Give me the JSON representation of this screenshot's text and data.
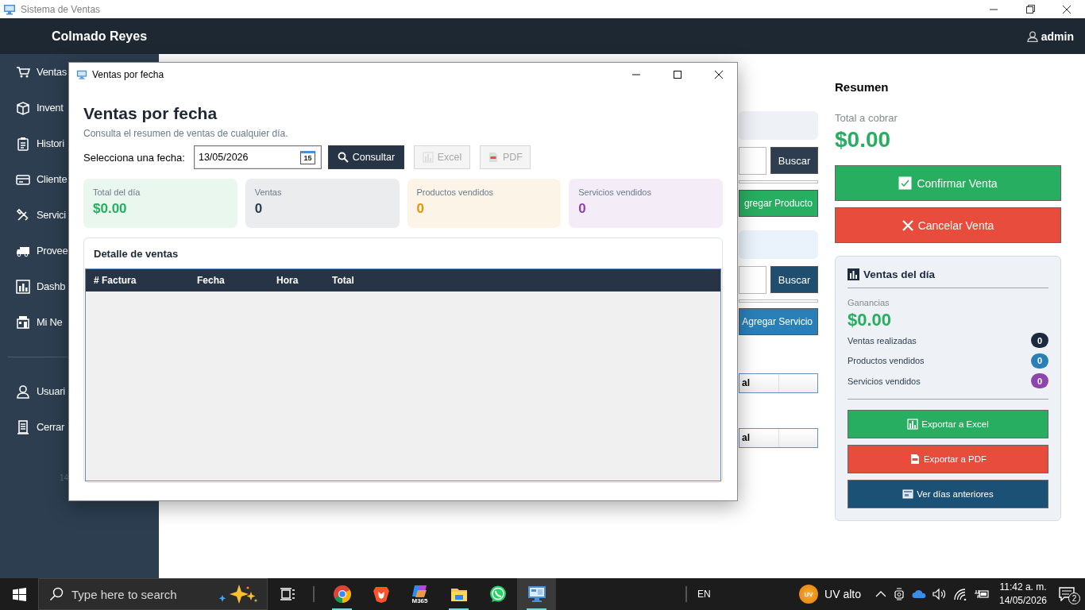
{
  "window": {
    "title": "Sistema de Ventas"
  },
  "header": {
    "brand": "Colmado Reyes",
    "user": "admin"
  },
  "sidebar": {
    "items": [
      {
        "label": "Ventas",
        "kind": "cart"
      },
      {
        "label": "Invent",
        "kind": "box"
      },
      {
        "label": "Histori",
        "kind": "clipboard"
      },
      {
        "label": "Cliente",
        "kind": "card"
      },
      {
        "label": "Servici",
        "kind": "tools"
      },
      {
        "label": "Provee",
        "kind": "truck"
      },
      {
        "label": "Dashb",
        "kind": "chart"
      },
      {
        "label": "Mi Ne",
        "kind": "building"
      }
    ],
    "bottom_items": [
      {
        "label": "Usuari",
        "kind": "user"
      },
      {
        "label": "Cerrar",
        "kind": "door"
      }
    ],
    "footer": "14"
  },
  "sales_form": {
    "product_search_button": "Buscar",
    "add_product_button": "gregar Producto",
    "service_search_button": "Buscar",
    "add_service_button": "Agregar Servicio",
    "product_table_cell": "al",
    "service_table_cell": "al"
  },
  "summary": {
    "title": "Resumen",
    "total_label": "Total a cobrar",
    "total": "$0.00",
    "confirm_button": "Confirmar Venta",
    "cancel_button": "Cancelar Venta",
    "daily": {
      "title": "Ventas del día",
      "profit_label": "Ganancias",
      "profit": "$0.00",
      "counts": [
        {
          "label": "Ventas realizadas",
          "value": "0",
          "color": "#1b2a3e"
        },
        {
          "label": "Productos vendidos",
          "value": "0",
          "color": "#2980b9"
        },
        {
          "label": "Servicios vendidos",
          "value": "0",
          "color": "#8e44ad"
        }
      ],
      "buttons": [
        {
          "label": "Exportar a Excel",
          "kind": "excel"
        },
        {
          "label": "Exportar a PDF",
          "kind": "pdf"
        },
        {
          "label": "Ver días anteriores",
          "kind": "history"
        }
      ]
    }
  },
  "dialog": {
    "title": "Ventas por fecha",
    "heading": "Ventas por fecha",
    "subtitle": "Consulta el resumen de ventas de cualquier día.",
    "date_label": "Selecciona una fecha:",
    "date_value": "13/05/2026",
    "calendar_day": "15",
    "buttons": [
      {
        "label": "Consultar",
        "kind": "search",
        "disabled": false
      },
      {
        "label": "Excel",
        "kind": "excel",
        "disabled": true
      },
      {
        "label": "PDF",
        "kind": "pdf",
        "disabled": true
      }
    ],
    "stats": [
      {
        "label": "Total del día",
        "value": "$0.00",
        "color": "#27ae60"
      },
      {
        "label": "Ventas",
        "value": "0",
        "color": "#2c3e50"
      },
      {
        "label": "Productos vendidos",
        "value": "0",
        "color": "#e3940d"
      },
      {
        "label": "Servicios vendidos",
        "value": "0",
        "color": "#8e44ad"
      }
    ],
    "table": {
      "title": "Detalle de ventas",
      "columns": [
        "# Factura",
        "Fecha",
        "Hora",
        "Total"
      ]
    }
  },
  "taskbar": {
    "search_placeholder": "Type here to search",
    "apps": [
      {
        "kind": "chrome",
        "running": true,
        "active": false
      },
      {
        "kind": "brave",
        "running": false,
        "active": false
      },
      {
        "kind": "m365",
        "label": "M365",
        "running": false,
        "active": false
      },
      {
        "kind": "explorer",
        "running": true,
        "active": false
      },
      {
        "kind": "whatsapp",
        "running": false,
        "active": false
      },
      {
        "kind": "app",
        "running": true,
        "active": true
      }
    ],
    "language": "EN",
    "weather": {
      "badge": "UV",
      "text": "UV alto"
    },
    "time": "11:42 a. m.",
    "date": "14/05/2026",
    "notifications": "2"
  }
}
